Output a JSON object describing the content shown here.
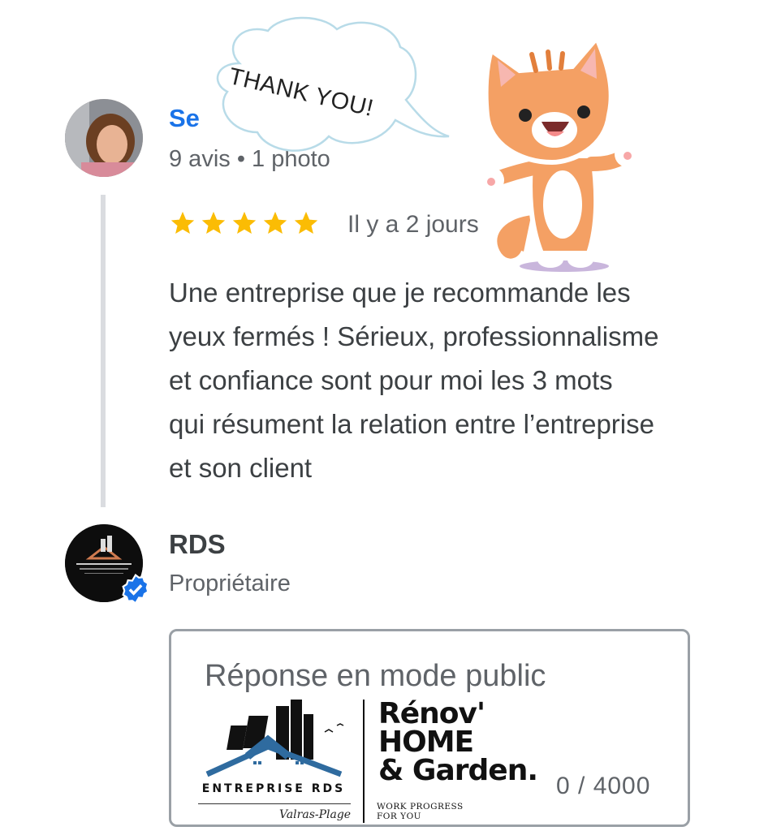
{
  "review": {
    "reviewer_name": "Se",
    "reviewer_meta": "9 avis • 1 photo",
    "rating": 5,
    "date": "Il y a 2 jours",
    "text": "Une entreprise que je recommande les\nyeux fermés ! Sérieux, professionnalisme\net confiance sont pour moi les 3 mots\nqui résument la relation entre l’entreprise\net son client"
  },
  "owner": {
    "name": "RDS",
    "role": "Propriétaire",
    "avatar_text": "ENTREPRISE RDS"
  },
  "reply": {
    "label": "Réponse en mode public",
    "counter": "0 / 4000"
  },
  "logo": {
    "line1": "Rénov'",
    "line2": "HOME",
    "line3": "& Garden.",
    "tagline1": "WORK PROGRESS",
    "tagline2": "FOR YOU",
    "company": "ENTREPRISE RDS",
    "place": "Valras-Plage"
  },
  "sticker": {
    "bubble_text": "THANK YOU!"
  },
  "colors": {
    "star": "#fbbc04",
    "link": "#1a73e8",
    "verified": "#1a73e8",
    "cat_orange": "#f4a064"
  },
  "icons": [
    "star-icon",
    "verified-badge-icon",
    "cat-sticker",
    "speech-bubble"
  ]
}
